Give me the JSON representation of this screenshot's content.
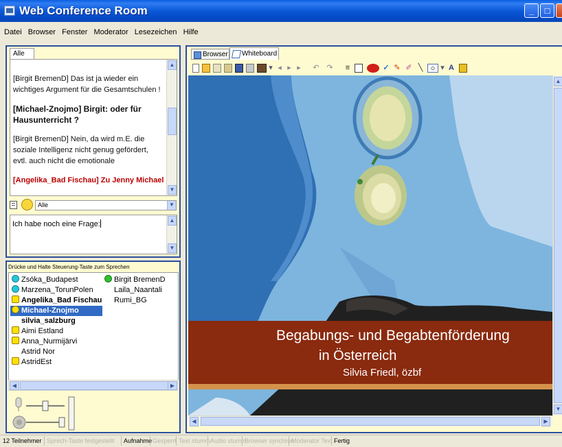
{
  "window": {
    "title": "Web Conference Room"
  },
  "menu": [
    "Datei",
    "Browser",
    "Fenster",
    "Moderator",
    "Lesezeichen",
    "Hilfe"
  ],
  "chat": {
    "tab": "Alle",
    "messages": [
      {
        "text": "[Birgit BremenD] Das ist ja wieder ein wichtiges Argument für die Gesamtschulen !",
        "style": "normal"
      },
      {
        "text": "[Michael-Znojmo] Birgit: oder für Hausunterricht ?",
        "style": "bold"
      },
      {
        "text": "[Birgit BremenD] Nein, da wird m.E. die soziale Intelligenz nicht genug gefördert, evtl. auch nicht die emotionale",
        "style": "normal"
      },
      {
        "text": "[Angelika_Bad Fischau] Zu Jenny Michael",
        "style": "cut"
      }
    ],
    "recipient": "Alle",
    "input_value": "Ich habe noch eine Frage:"
  },
  "users": {
    "hint": "Drücke und Halte Steuerung-Taste zum Sprechen",
    "column1": [
      {
        "name": "Zsóka_Budapest",
        "icon": "teal-speech-icon",
        "bold": false,
        "selected": false
      },
      {
        "name": "Marzena_TorunPolen",
        "icon": "teal-speech-icon",
        "bold": false,
        "selected": false
      },
      {
        "name": "Angelika_Bad Fischau",
        "icon": "yellow-hand-icon",
        "bold": true,
        "selected": false
      },
      {
        "name": "Michael-Znojmo",
        "icon": "yellow-moderator-icon",
        "bold": true,
        "selected": true
      },
      {
        "name": "silvia_salzburg",
        "icon": "",
        "bold": true,
        "selected": false
      },
      {
        "name": "Aimi Estland",
        "icon": "yellow-hand-icon",
        "bold": false,
        "selected": false
      },
      {
        "name": "Anna_Nurmijärvi",
        "icon": "yellow-hand-icon",
        "bold": false,
        "selected": false
      },
      {
        "name": "Astrid Nor",
        "icon": "",
        "bold": false,
        "selected": false
      },
      {
        "name": "AstridEst",
        "icon": "yellow-hand-icon",
        "bold": false,
        "selected": false
      }
    ],
    "column2": [
      {
        "name": "Birgit BremenD",
        "icon": "green-speaker-icon"
      },
      {
        "name": "Laila_Naantali",
        "icon": ""
      },
      {
        "name": "Rumi_BG",
        "icon": ""
      }
    ]
  },
  "whiteboard": {
    "tabs": [
      "Browser",
      "Whiteboard"
    ],
    "active_tab": "Whiteboard",
    "slide": {
      "title": "Begabungs- und Begabtenförderung",
      "subtitle": "in Österreich",
      "author": "Silvia Friedl, özbf"
    }
  },
  "status": {
    "participants": "12 Teilnehmer",
    "items": [
      {
        "label": "Sprech-Taste festgestellt",
        "active": false
      },
      {
        "label": "Aufnahme",
        "active": true
      },
      {
        "label": "Gesperrt",
        "active": false
      },
      {
        "label": "Text stumm",
        "active": false
      },
      {
        "label": "Audio stumm",
        "active": false
      },
      {
        "label": "Browser synchron",
        "active": false
      },
      {
        "label": "Moderator Text",
        "active": false
      },
      {
        "label": "Fertig",
        "active": true
      }
    ]
  },
  "colors": {
    "titlebar": "#0a58d8",
    "panel_border": "#2c4f9e",
    "panel_bg": "#fffbd0",
    "banner": "#8a2a0e",
    "selection": "#316ac5"
  }
}
